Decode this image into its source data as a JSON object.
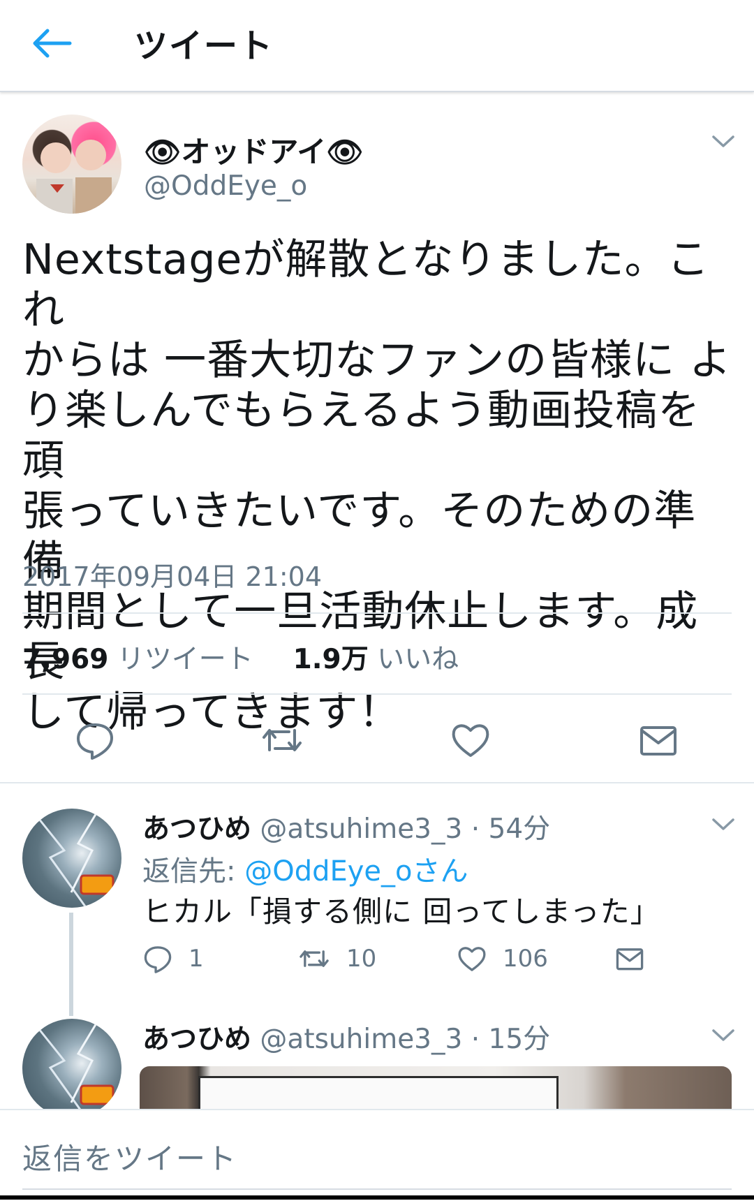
{
  "header": {
    "title": "ツイート",
    "back_icon": "arrow-left-icon",
    "accent": "#1da1f2"
  },
  "main_tweet": {
    "display_name": "👁オッドアイ👁",
    "handle": "@OddEye_o",
    "text_lines": [
      "Nextstageが解散となりました。これ",
      "からは 一番大切なファンの皆様に よ",
      "り楽しんでもらえるよう動画投稿を頑",
      "張っていきたいです。そのための準備",
      "期間として一旦活動休止します。成長",
      "して帰ってきます！"
    ],
    "timestamp": "2017年09月04日 21:04",
    "retweet_count": "7,969",
    "retweet_label": "リツイート",
    "like_count": "1.9万",
    "like_label": "いいね"
  },
  "replies": [
    {
      "display_name": "あつひめ",
      "handle_time": "@atsuhime3_3 · 54分",
      "reply_to_label": "返信先:",
      "reply_to_handle": "@OddEye_oさん",
      "text": "ヒカル「損する側に 回ってしまった」",
      "reply_count": "1",
      "retweet_count": "10",
      "like_count": "106"
    },
    {
      "display_name": "あつひめ",
      "handle_time": "@atsuhime3_3 · 15分"
    }
  ],
  "compose": {
    "placeholder": "返信をツイート"
  }
}
